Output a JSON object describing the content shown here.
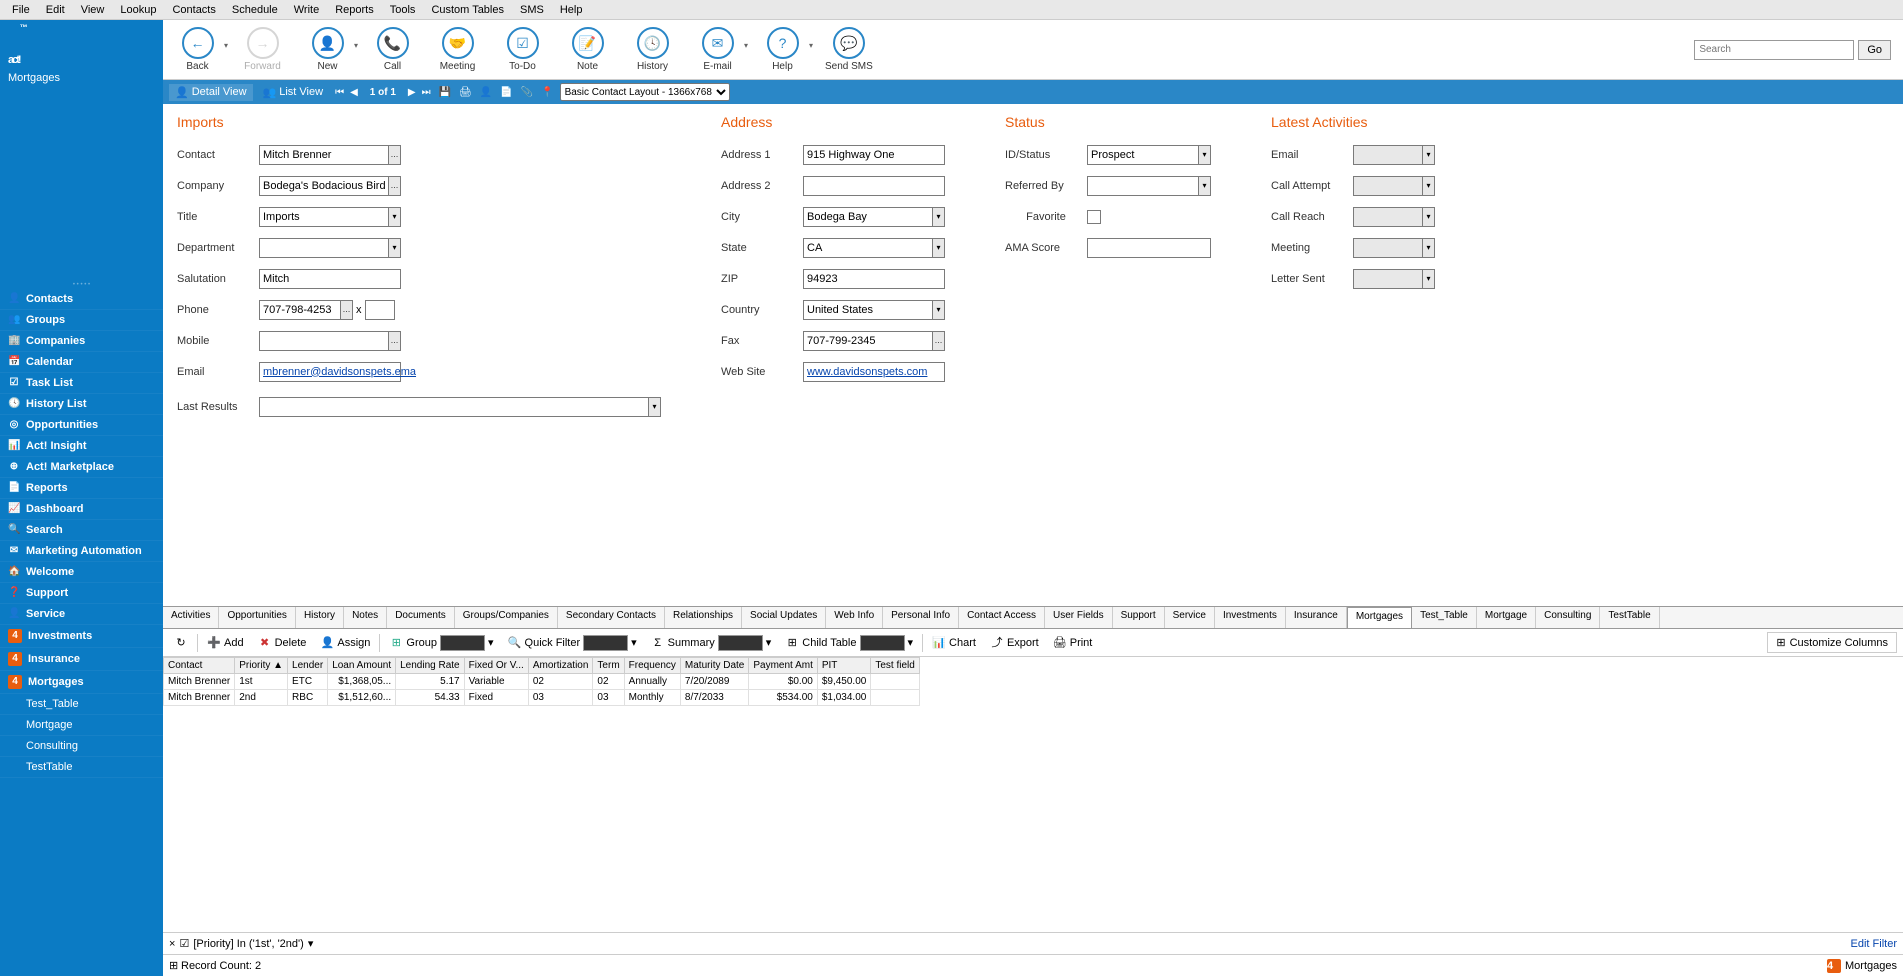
{
  "menu": [
    "File",
    "Edit",
    "View",
    "Lookup",
    "Contacts",
    "Schedule",
    "Write",
    "Reports",
    "Tools",
    "Custom Tables",
    "SMS",
    "Help"
  ],
  "logo": {
    "text": "act!",
    "sub": "Mortgages",
    "tm": "™"
  },
  "nav": [
    {
      "icon": "👤",
      "label": "Contacts"
    },
    {
      "icon": "👥",
      "label": "Groups"
    },
    {
      "icon": "🏢",
      "label": "Companies"
    },
    {
      "icon": "📅",
      "label": "Calendar"
    },
    {
      "icon": "☑",
      "label": "Task List"
    },
    {
      "icon": "🕓",
      "label": "History List"
    },
    {
      "icon": "◎",
      "label": "Opportunities"
    },
    {
      "icon": "📊",
      "label": "Act! Insight"
    },
    {
      "icon": "⊕",
      "label": "Act! Marketplace"
    },
    {
      "icon": "📄",
      "label": "Reports"
    },
    {
      "icon": "📈",
      "label": "Dashboard"
    },
    {
      "icon": "🔍",
      "label": "Search"
    },
    {
      "icon": "✉",
      "label": "Marketing Automation"
    },
    {
      "icon": "🏠",
      "label": "Welcome"
    },
    {
      "icon": "❓",
      "label": "Support"
    },
    {
      "icon": "👤",
      "label": "Service"
    },
    {
      "icon": "4",
      "label": "Investments",
      "orange": true
    },
    {
      "icon": "4",
      "label": "Insurance",
      "orange": true
    },
    {
      "icon": "4",
      "label": "Mortgages",
      "orange": true
    },
    {
      "icon": "",
      "label": "Test_Table",
      "plain": true
    },
    {
      "icon": "",
      "label": "Mortgage",
      "plain": true
    },
    {
      "icon": "",
      "label": "Consulting",
      "plain": true
    },
    {
      "icon": "",
      "label": "TestTable",
      "plain": true
    }
  ],
  "toolbar": [
    {
      "icon": "←",
      "label": "Back",
      "arrow": true
    },
    {
      "icon": "→",
      "label": "Forward",
      "disabled": true
    },
    {
      "icon": "👤",
      "label": "New",
      "arrow": true
    },
    {
      "icon": "📞",
      "label": "Call"
    },
    {
      "icon": "🤝",
      "label": "Meeting"
    },
    {
      "icon": "☑",
      "label": "To-Do"
    },
    {
      "icon": "📝",
      "label": "Note"
    },
    {
      "icon": "🕓",
      "label": "History"
    },
    {
      "icon": "✉",
      "label": "E-mail",
      "arrow": true
    },
    {
      "icon": "?",
      "label": "Help",
      "arrow": true
    },
    {
      "icon": "💬",
      "label": "Send SMS"
    }
  ],
  "search": {
    "placeholder": "Search",
    "go": "Go"
  },
  "viewbar": {
    "detail": "Detail View",
    "list": "List View",
    "pager": "1 of 1",
    "layout": "Basic Contact Layout - 1366x768"
  },
  "sections": {
    "businessCard": {
      "title": "Imports",
      "contact_l": "Contact",
      "contact": "Mitch Brenner",
      "company_l": "Company",
      "company": "Bodega's Bodacious Birds",
      "title_l": "Title",
      "department_l": "Department",
      "department": "",
      "salutation_l": "Salutation",
      "salutation": "Mitch",
      "phone_l": "Phone",
      "phone": "707-798-4253",
      "ext": "",
      "mobile_l": "Mobile",
      "mobile": "",
      "email_l": "Email",
      "email": "mbrenner@davidsonspets.ema",
      "lastresults_l": "Last Results",
      "lastresults": ""
    },
    "address": {
      "title": "Address",
      "addr1_l": "Address 1",
      "addr1": "915 Highway One",
      "addr2_l": "Address 2",
      "addr2": "",
      "city_l": "City",
      "city": "Bodega Bay",
      "state_l": "State",
      "state": "CA",
      "zip_l": "ZIP",
      "zip": "94923",
      "country_l": "Country",
      "country": "United States",
      "fax_l": "Fax",
      "fax": "707-799-2345",
      "web_l": "Web Site",
      "web": "www.davidsonspets.com"
    },
    "status": {
      "title": "Status",
      "idstatus_l": "ID/Status",
      "idstatus": "Prospect",
      "referred_l": "Referred By",
      "referred": "",
      "favorite_l": "Favorite",
      "ama_l": "AMA Score",
      "ama": ""
    },
    "activities": {
      "title": "Latest Activities",
      "email_l": "Email",
      "call_attempt_l": "Call Attempt",
      "call_reach_l": "Call Reach",
      "meeting_l": "Meeting",
      "letter_l": "Letter Sent"
    }
  },
  "tabs": [
    "Activities",
    "Opportunities",
    "History",
    "Notes",
    "Documents",
    "Groups/Companies",
    "Secondary Contacts",
    "Relationships",
    "Social Updates",
    "Web Info",
    "Personal Info",
    "Contact Access",
    "User Fields",
    "Support",
    "Service",
    "Investments",
    "Insurance",
    "Mortgages",
    "Test_Table",
    "Mortgage",
    "Consulting",
    "TestTable"
  ],
  "active_tab": "Mortgages",
  "tabToolbar": {
    "add": "Add",
    "delete": "Delete",
    "assign": "Assign",
    "group": "Group",
    "quickfilter": "Quick Filter",
    "summary": "Summary",
    "childtable": "Child Table",
    "chart": "Chart",
    "export": "Export",
    "print": "Print",
    "refresh": "↻",
    "customize": "Customize Columns"
  },
  "grid": {
    "headers": [
      "Contact",
      "Priority ▲",
      "Lender",
      "Loan Amount",
      "Lending Rate",
      "Fixed Or V...",
      "Amortization",
      "Term",
      "Frequency",
      "Maturity Date",
      "Payment Amt",
      "PIT",
      "Test field"
    ],
    "rows": [
      {
        "contact": "Mitch Brenner",
        "priority": "1st",
        "lender": "ETC",
        "loan": "$1,368,05...",
        "rate": "5.17",
        "fixed": "Variable",
        "amort": "02",
        "term": "02",
        "freq": "Annually",
        "maturity": "7/20/2089",
        "payment": "$0.00",
        "pit": "$9,450.00",
        "test": ""
      },
      {
        "contact": "Mitch Brenner",
        "priority": "2nd",
        "lender": "RBC",
        "loan": "$1,512,60...",
        "rate": "54.33",
        "fixed": "Fixed",
        "amort": "03",
        "term": "03",
        "freq": "Monthly",
        "maturity": "8/7/2033",
        "payment": "$534.00",
        "pit": "$1,034.00",
        "test": ""
      }
    ]
  },
  "filter": {
    "text": "[Priority] In ('1st', '2nd')",
    "edit": "Edit Filter",
    "close": "×",
    "check": "☑"
  },
  "status_bar": {
    "count": "Record Count: 2",
    "right_label": "Mortgages"
  }
}
